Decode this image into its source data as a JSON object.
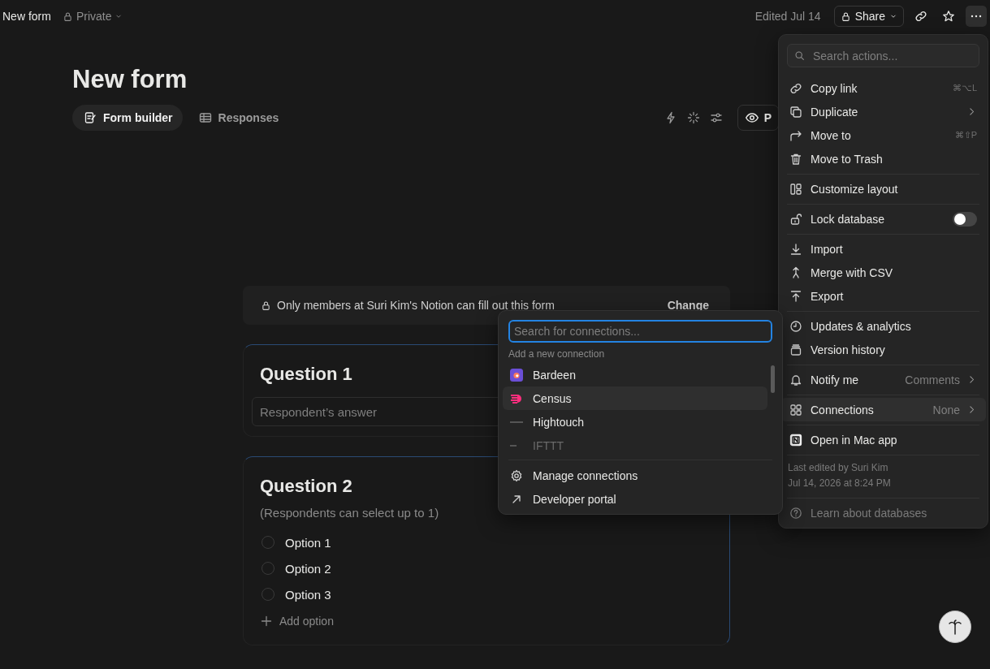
{
  "topbar": {
    "title": "New form",
    "privacy": "Private",
    "edited": "Edited Jul 14",
    "share": "Share"
  },
  "page": {
    "title": "New form",
    "tabs": [
      {
        "label": "Form builder",
        "selected": true
      },
      {
        "label": "Responses",
        "selected": false
      }
    ],
    "preview": "P"
  },
  "form": {
    "notice": "Only members at Suri Kim's Notion can fill out this form",
    "notice_action": "Change",
    "questions": [
      {
        "kind": "text",
        "title": "Question 1",
        "placeholder": "Respondent’s answer"
      },
      {
        "kind": "choice",
        "title": "Question 2",
        "hint": "(Respondents can select up to 1)",
        "options": [
          {
            "label": "Option 1",
            "checked": false
          },
          {
            "label": "Option 2",
            "checked": false
          },
          {
            "label": "Option 3",
            "checked": false
          }
        ],
        "add_label": "Add option"
      }
    ]
  },
  "actions_menu": {
    "search_placeholder": "Search actions...",
    "groups": [
      [
        {
          "label": "Copy link",
          "shortcut": "⌘⌥L",
          "selected": false
        },
        {
          "label": "Duplicate",
          "submenu": true,
          "selected": false
        },
        {
          "label": "Move to",
          "shortcut": "⌘⇧P",
          "selected": false
        },
        {
          "label": "Move to Trash",
          "selected": false
        }
      ],
      [
        {
          "label": "Customize layout",
          "selected": false
        }
      ],
      [
        {
          "label": "Lock database",
          "kind": "toggle",
          "on": false,
          "selected": false
        }
      ],
      [
        {
          "label": "Import",
          "selected": false
        },
        {
          "label": "Merge with CSV",
          "selected": false
        },
        {
          "label": "Export",
          "selected": false
        }
      ],
      [
        {
          "label": "Updates & analytics",
          "selected": false
        },
        {
          "label": "Version history",
          "selected": false
        }
      ],
      [
        {
          "label": "Notify me",
          "value": "Comments",
          "submenu": true,
          "selected": false
        }
      ],
      [
        {
          "label": "Connections",
          "value": "None",
          "submenu": true,
          "selected": true
        }
      ],
      [
        {
          "label": "Open in Mac app",
          "selected": false
        }
      ]
    ],
    "meta": [
      "Last edited by Suri Kim",
      "Jul 14, 2026 at 8:24 PM"
    ],
    "help": "Learn about databases"
  },
  "connections_popup": {
    "search_placeholder": "Search for connections...",
    "section": "Add a new connection",
    "items": [
      {
        "label": "Bardeen",
        "selected": false,
        "faded": false
      },
      {
        "label": "Census",
        "selected": true,
        "faded": false
      },
      {
        "label": "Hightouch",
        "selected": false,
        "faded": false
      },
      {
        "label": "IFTTT",
        "selected": false,
        "faded": true
      }
    ],
    "footer_items": [
      {
        "label": "Manage connections"
      },
      {
        "label": "Developer portal"
      }
    ]
  }
}
